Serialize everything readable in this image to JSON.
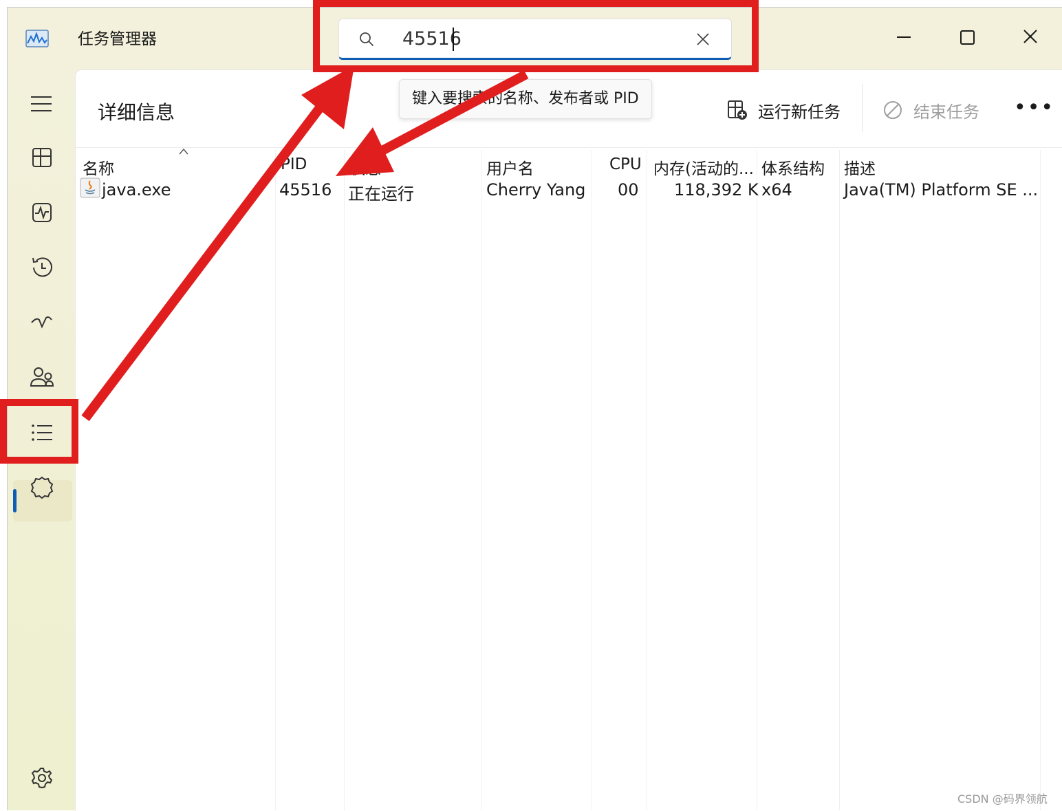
{
  "window": {
    "title": "任务管理器",
    "controls": [
      "minimize",
      "maximize",
      "close"
    ]
  },
  "search": {
    "value": "45516",
    "tooltip": "键入要搜索的名称、发布者或 PID"
  },
  "nav": {
    "items": [
      {
        "name": "menu-icon"
      },
      {
        "name": "processes-icon"
      },
      {
        "name": "performance-icon"
      },
      {
        "name": "app-history-icon"
      },
      {
        "name": "startup-apps-icon"
      },
      {
        "name": "users-icon"
      },
      {
        "name": "details-icon",
        "active": true
      },
      {
        "name": "services-icon"
      },
      {
        "name": "settings-icon"
      }
    ]
  },
  "page": {
    "title": "详细信息",
    "run_new_task": "运行新任务",
    "end_task": "结束任务",
    "more": "•••"
  },
  "table": {
    "headers": [
      "名称",
      "PID",
      "状态",
      "用户名",
      "CPU",
      "内存(活动的...",
      "体系结构",
      "描述"
    ],
    "rows": [
      {
        "name": "java.exe",
        "pid": "45516",
        "status": "正在运行",
        "user": "Cherry Yang",
        "cpu": "00",
        "memory": "118,392 K",
        "arch": "x64",
        "description": "Java(TM) Platform SE ..."
      }
    ]
  },
  "colors": {
    "accent": "#0f5cb5",
    "annotation": "#e01e1e",
    "nav_bg": "#f1f0d6"
  },
  "watermark": "CSDN @码界领航"
}
